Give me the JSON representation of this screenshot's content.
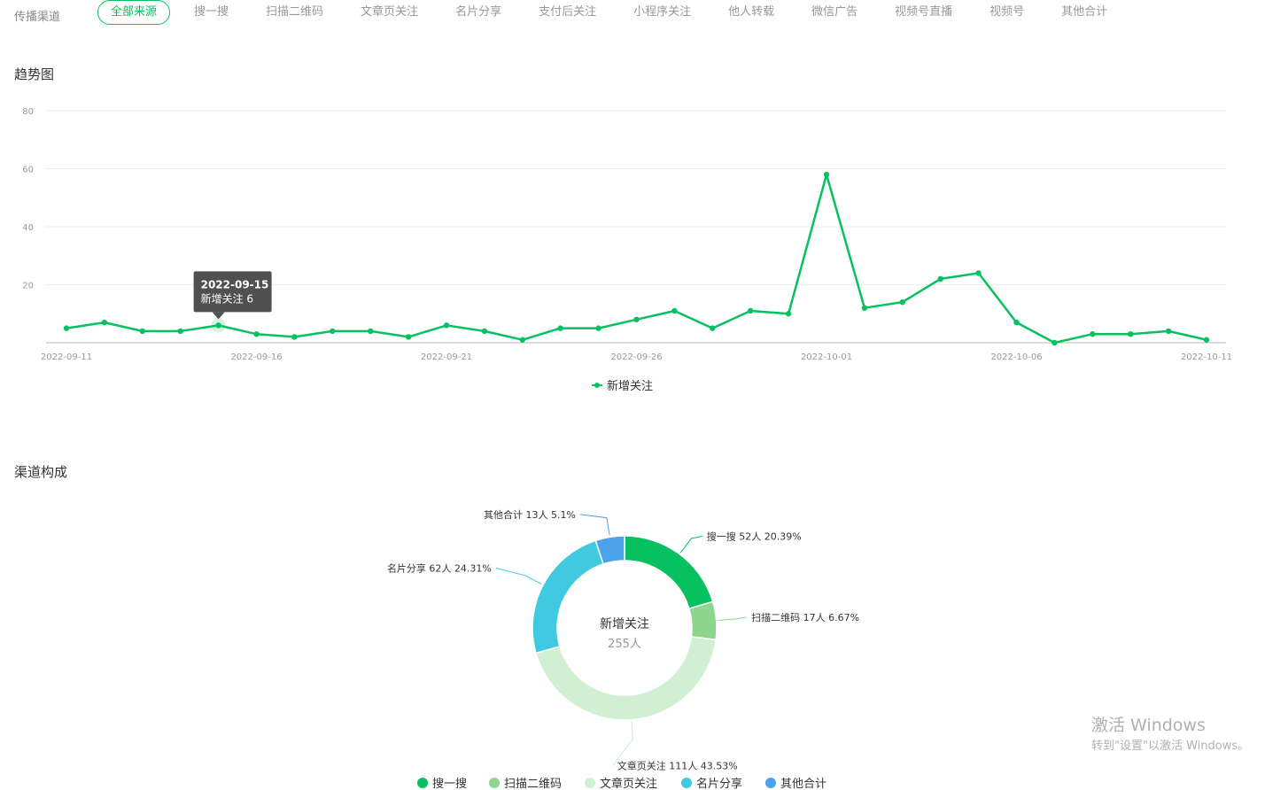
{
  "channel": {
    "label": "传播渠道",
    "tabs": [
      "全部来源",
      "搜一搜",
      "扫描二维码",
      "文章页关注",
      "名片分享",
      "支付后关注",
      "小程序关注",
      "他人转载",
      "微信广告",
      "视频号直播",
      "视频号",
      "其他合计"
    ],
    "active_tab": "全部来源"
  },
  "trend": {
    "title": "趋势图",
    "tooltip": {
      "date": "2022-09-15",
      "text": "新增关注 6"
    }
  },
  "composition": {
    "title": "渠道构成"
  },
  "accent_color": "#07c160",
  "chart_data": [
    {
      "type": "line",
      "x": [
        "2022-09-11",
        "2022-09-12",
        "2022-09-13",
        "2022-09-14",
        "2022-09-15",
        "2022-09-16",
        "2022-09-17",
        "2022-09-18",
        "2022-09-19",
        "2022-09-20",
        "2022-09-21",
        "2022-09-22",
        "2022-09-23",
        "2022-09-24",
        "2022-09-25",
        "2022-09-26",
        "2022-09-27",
        "2022-09-28",
        "2022-09-29",
        "2022-09-30",
        "2022-10-01",
        "2022-10-02",
        "2022-10-03",
        "2022-10-04",
        "2022-10-05",
        "2022-10-06",
        "2022-10-07",
        "2022-10-08",
        "2022-10-09",
        "2022-10-10",
        "2022-10-11"
      ],
      "x_tick_labels": [
        "2022-09-11",
        "2022-09-16",
        "2022-09-21",
        "2022-09-26",
        "2022-10-01",
        "2022-10-06",
        "2022-10-11"
      ],
      "series": [
        {
          "name": "新增关注",
          "color": "#07c160",
          "values": [
            5,
            7,
            4,
            4,
            6,
            3,
            2,
            4,
            4,
            2,
            6,
            4,
            1,
            5,
            5,
            8,
            11,
            5,
            11,
            10,
            58,
            12,
            14,
            22,
            24,
            7,
            0,
            3,
            3,
            4,
            1
          ]
        }
      ],
      "ylim": [
        0,
        80
      ],
      "y_ticks": [
        20,
        40,
        60,
        80
      ],
      "grid": true,
      "legend": "bottom-center"
    },
    {
      "type": "pie",
      "center_title": "新增关注",
      "center_value": "255人",
      "slices": [
        {
          "name": "搜一搜",
          "value": 52,
          "percent": "20.39%",
          "label": "搜一搜 52人 20.39%",
          "color": "#07c160"
        },
        {
          "name": "扫描二维码",
          "value": 17,
          "percent": "6.67%",
          "label": "扫描二维码 17人 6.67%",
          "color": "#8ed68e"
        },
        {
          "name": "文章页关注",
          "value": 111,
          "percent": "43.53%",
          "label": "文章页关注 111人 43.53%",
          "color": "#d0efd3"
        },
        {
          "name": "名片分享",
          "value": 62,
          "percent": "24.31%",
          "label": "名片分享 62人 24.31%",
          "color": "#40c9e0"
        },
        {
          "name": "其他合计",
          "value": 13,
          "percent": "5.1%",
          "label": "其他合计 13人 5.1%",
          "color": "#4da3ea"
        }
      ],
      "legend": "bottom-center"
    }
  ],
  "watermark": {
    "title": "激活 Windows",
    "subtitle": "转到\"设置\"以激活 Windows。"
  }
}
